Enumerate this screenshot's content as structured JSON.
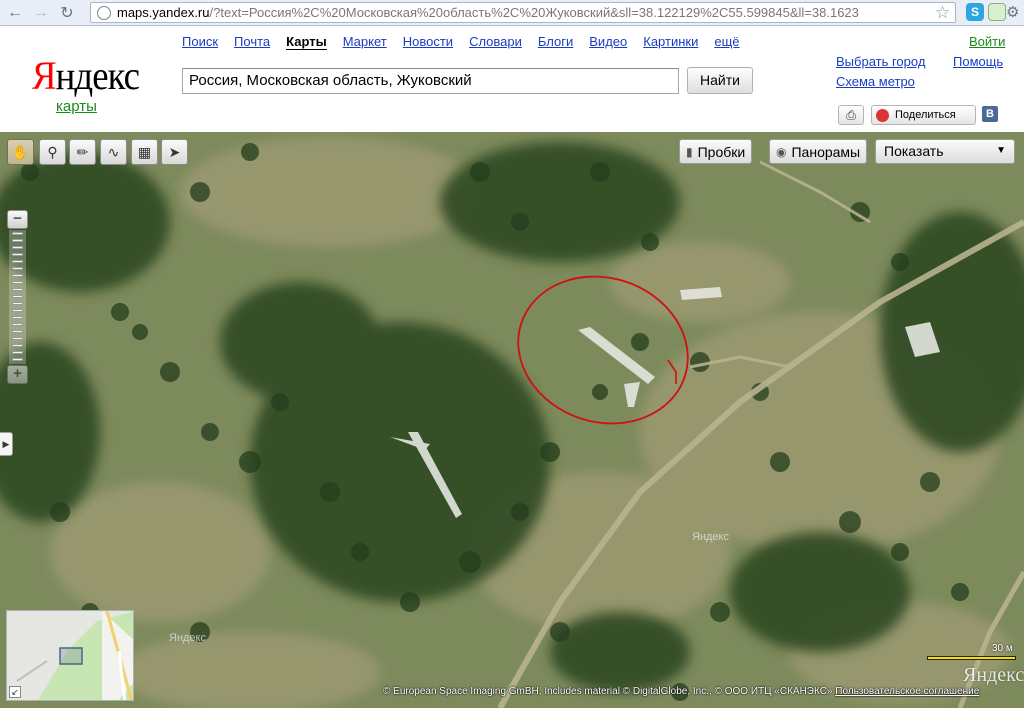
{
  "browser": {
    "url_host": "maps.yandex.ru",
    "url_path": "/?text=Россия%2C%20Московская%20область%2C%20Жуковский&sll=38.122129%2C55.599845&ll=38.1623",
    "back_icon": "back-arrow-icon",
    "forward_icon": "forward-arrow-icon",
    "reload_icon": "reload-icon",
    "ext1_label": "S"
  },
  "header": {
    "logo_first": "Я",
    "logo_rest": "ндекс",
    "logo_sub": "карты",
    "services": [
      "Поиск",
      "Почта",
      "Карты",
      "Маркет",
      "Новости",
      "Словари",
      "Блоги",
      "Видео",
      "Картинки",
      "ещё"
    ],
    "active_service": "Карты",
    "search_value": "Россия, Московская область, Жуковский",
    "search_button": "Найти",
    "login": "Войти",
    "choose_city": "Выбрать город",
    "help": "Помощь",
    "metro": "Схема метро",
    "share": "Поделиться",
    "vk": "В"
  },
  "map": {
    "layers": {
      "traffic": "Пробки",
      "panoramas": "Панорамы",
      "show": "Показать"
    },
    "tools": [
      "hand-icon",
      "magnifier-icon",
      "ruler-icon",
      "route-icon",
      "layers-icon",
      "cursor-icon"
    ],
    "watermarks": [
      "Яндекс",
      "Яндекс"
    ],
    "scale_label": "30 м",
    "logo": "Яндекс",
    "copyright": "© European Space Imaging GmBH, Includes material © DigitalGlobe, Inc., © ООО ИТЦ «СКАНЭКС»",
    "agreement": "Пользовательское соглашение"
  },
  "colors": {
    "link": "#1a3dc1",
    "logo_red": "#ff0000",
    "maps_green": "#1a8c1a",
    "annotation": "#d01010"
  }
}
